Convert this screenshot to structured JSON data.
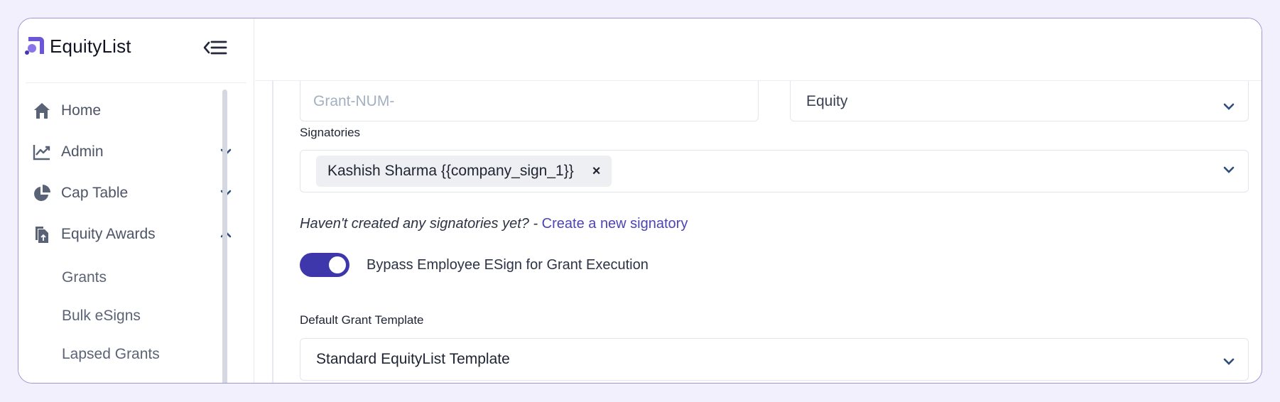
{
  "app": {
    "name": "EquityList"
  },
  "sidebar": {
    "items": [
      {
        "label": "Home",
        "icon": "home-icon"
      },
      {
        "label": "Admin",
        "icon": "trend-chart-icon",
        "expanded": false
      },
      {
        "label": "Cap Table",
        "icon": "pie-chart-icon",
        "expanded": false
      },
      {
        "label": "Equity Awards",
        "icon": "document-upload-icon",
        "expanded": true
      }
    ],
    "subitems": [
      {
        "label": "Grants"
      },
      {
        "label": "Bulk eSigns"
      },
      {
        "label": "Lapsed Grants"
      }
    ]
  },
  "form": {
    "grant_number_placeholder": "Grant-NUM-",
    "grant_type_value": "Equity",
    "signatories": {
      "label": "Signatories",
      "chips": [
        {
          "text": "Kashish Sharma {{company_sign_1}}",
          "remove": "×"
        }
      ]
    },
    "hint": {
      "prefix": "Haven't created any signatories yet? - ",
      "link": "Create a new signatory"
    },
    "bypass_toggle": {
      "label": "Bypass Employee ESign for Grant Execution",
      "on": true
    },
    "template": {
      "label": "Default Grant Template",
      "value": "Standard EquityList Template"
    }
  },
  "colors": {
    "accent": "#3e37ac",
    "link": "#4d44b5",
    "frame_border": "#9f96d6",
    "page_bg": "#f3f0fd"
  }
}
